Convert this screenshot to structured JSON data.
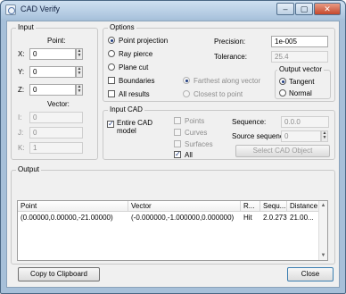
{
  "window": {
    "title": "CAD Verify",
    "min": "–",
    "max": "▢",
    "close": "✕"
  },
  "input": {
    "legend": "Input",
    "point_label": "Point:",
    "x_label": "X:",
    "x_value": "0",
    "y_label": "Y:",
    "y_value": "0",
    "z_label": "Z:",
    "z_value": "0",
    "vector_label": "Vector:",
    "i_label": "I:",
    "i_value": "0",
    "j_label": "J:",
    "j_value": "0",
    "k_label": "K:",
    "k_value": "1"
  },
  "options": {
    "legend": "Options",
    "point_projection": "Point projection",
    "ray_pierce": "Ray pierce",
    "plane_cut": "Plane cut",
    "boundaries": "Boundaries",
    "all_results": "All results",
    "farthest": "Farthest along vector",
    "closest": "Closest to point",
    "precision_label": "Precision:",
    "precision_value": "1e-005",
    "tolerance_label": "Tolerance:",
    "tolerance_value": "25.4",
    "output_vector_legend": "Output vector",
    "tangent": "Tangent",
    "normal": "Normal"
  },
  "input_cad": {
    "legend": "Input CAD",
    "entire_model_line1": "Entire CAD",
    "entire_model_line2": "model",
    "points": "Points",
    "curves": "Curves",
    "surfaces": "Surfaces",
    "all": "All",
    "sequence_label": "Sequence:",
    "sequence_value": "0.0.0",
    "source_sequence_label": "Source sequence:",
    "source_sequence_value": "0",
    "select_button": "Select CAD Object"
  },
  "output": {
    "legend": "Output",
    "columns": [
      "Point",
      "Vector",
      "R...",
      "Sequ...",
      "Distance"
    ],
    "rows": [
      [
        "(0.00000,0.00000,-21.00000)",
        "(-0.000000,-1.000000,0.000000)",
        "Hit",
        "2.0.273",
        "21.00..."
      ]
    ]
  },
  "buttons": {
    "copy": "Copy to Clipboard",
    "close": "Close"
  }
}
